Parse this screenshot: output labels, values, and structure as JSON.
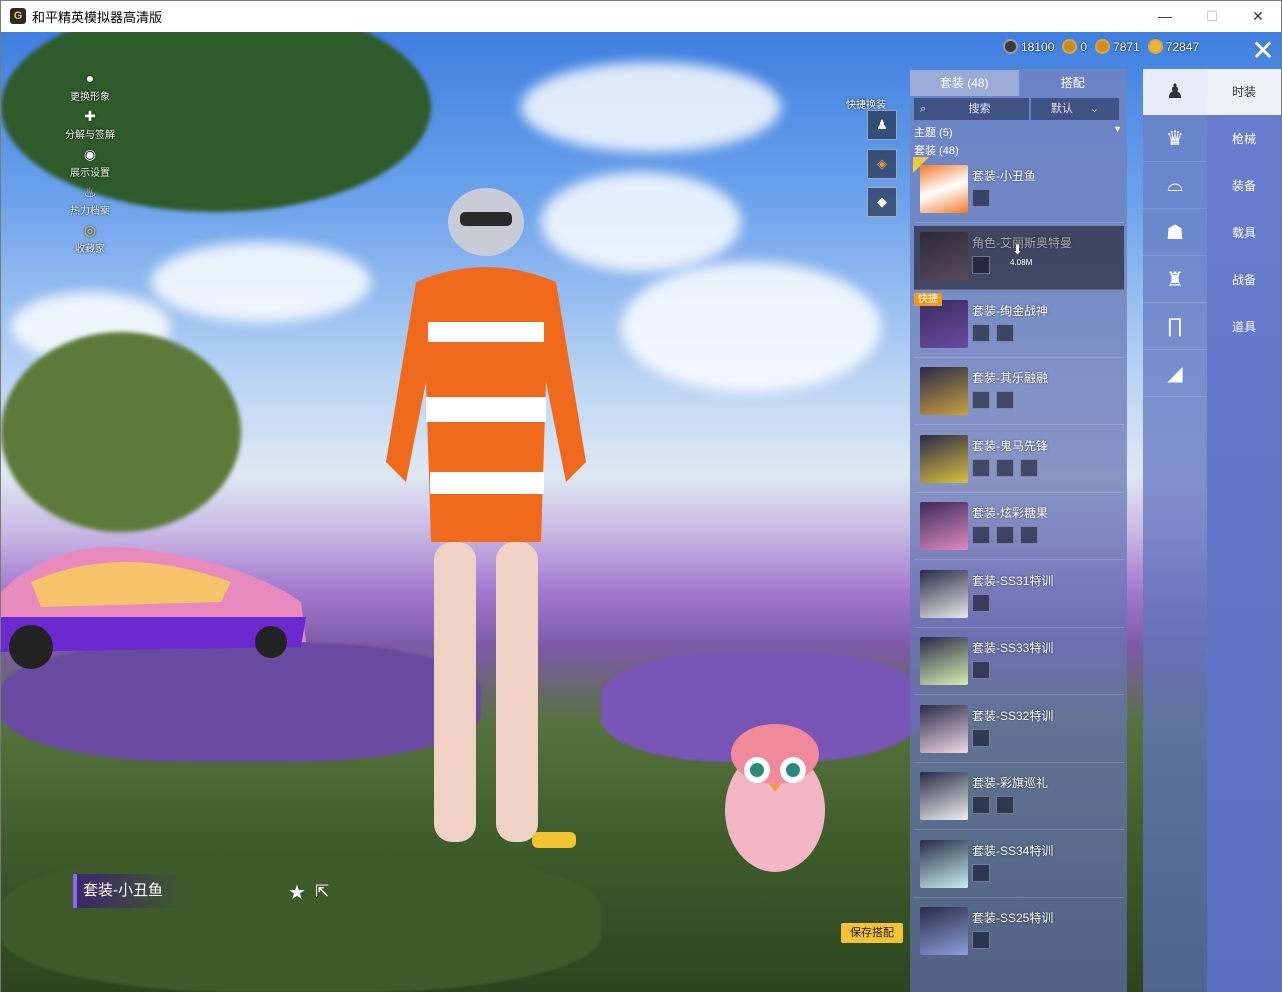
{
  "window": {
    "title": "和平精英模拟器高清版",
    "app_icon_letter": "G",
    "controls": {
      "minimize": "—",
      "maximize": "☐",
      "close": "✕"
    }
  },
  "left_menu": [
    {
      "label": "更换形象",
      "icon": "person-icon"
    },
    {
      "label": "分解与签解",
      "icon": "puzzle-icon"
    },
    {
      "label": "展示设置",
      "icon": "eye-icon"
    },
    {
      "label": "热力档案",
      "icon": "flame-icon"
    },
    {
      "label": "收藏家",
      "icon": "medal-icon"
    }
  ],
  "currency": [
    {
      "value": "18100",
      "color": "#3a3a3a"
    },
    {
      "value": "0",
      "color": "#c48a2a"
    },
    {
      "value": "7871",
      "color": "#d08a20"
    },
    {
      "value": "72847",
      "color": "#e8b830"
    }
  ],
  "close_button": "✕",
  "quick_change": {
    "label": "快捷换装",
    "buttons": [
      "outfit-swap-icon",
      "badge-icon",
      "diamond-icon"
    ]
  },
  "panel": {
    "tabs": [
      {
        "label": "套装 (48)",
        "active": true
      },
      {
        "label": "搭配",
        "active": false
      }
    ],
    "search": {
      "placeholder": "搜索"
    },
    "sort": {
      "value": "默认"
    },
    "theme_header": "主题 (5)",
    "suit_header": "套装 (48)",
    "items": [
      {
        "name": "套装-小丑鱼",
        "subs": 1,
        "selected_check": true
      },
      {
        "name": "角色-艾丽斯奥特曼",
        "subs": 1,
        "selected": true,
        "download": "4.08M"
      },
      {
        "name": "套装-绚金战神",
        "subs": 2,
        "badge": "快捷"
      },
      {
        "name": "套装-其乐融融",
        "subs": 2
      },
      {
        "name": "套装-鬼马先锋",
        "subs": 3
      },
      {
        "name": "套装-炫彩糖果",
        "subs": 3
      },
      {
        "name": "套装-SS31特训",
        "subs": 1
      },
      {
        "name": "套装-SS33特训",
        "subs": 1
      },
      {
        "name": "套装-SS32特训",
        "subs": 1
      },
      {
        "name": "套装-彩旗巡礼",
        "subs": 2
      },
      {
        "name": "套装-SS34特训",
        "subs": 1
      },
      {
        "name": "套装-SS25特训",
        "subs": 1
      }
    ]
  },
  "categories": [
    {
      "icon": "outfit-icon",
      "active": true
    },
    {
      "icon": "hat-icon"
    },
    {
      "icon": "glasses-icon"
    },
    {
      "icon": "mask-icon"
    },
    {
      "icon": "top-icon"
    },
    {
      "icon": "pants-icon"
    },
    {
      "icon": "shoes-icon"
    }
  ],
  "right_tabs": [
    {
      "label": "时装",
      "active": true
    },
    {
      "label": "枪械"
    },
    {
      "label": "装备"
    },
    {
      "label": "载具"
    },
    {
      "label": "战备"
    },
    {
      "label": "道具"
    }
  ],
  "outfit_label": "套装-小丑鱼",
  "save_button": "保存搭配"
}
